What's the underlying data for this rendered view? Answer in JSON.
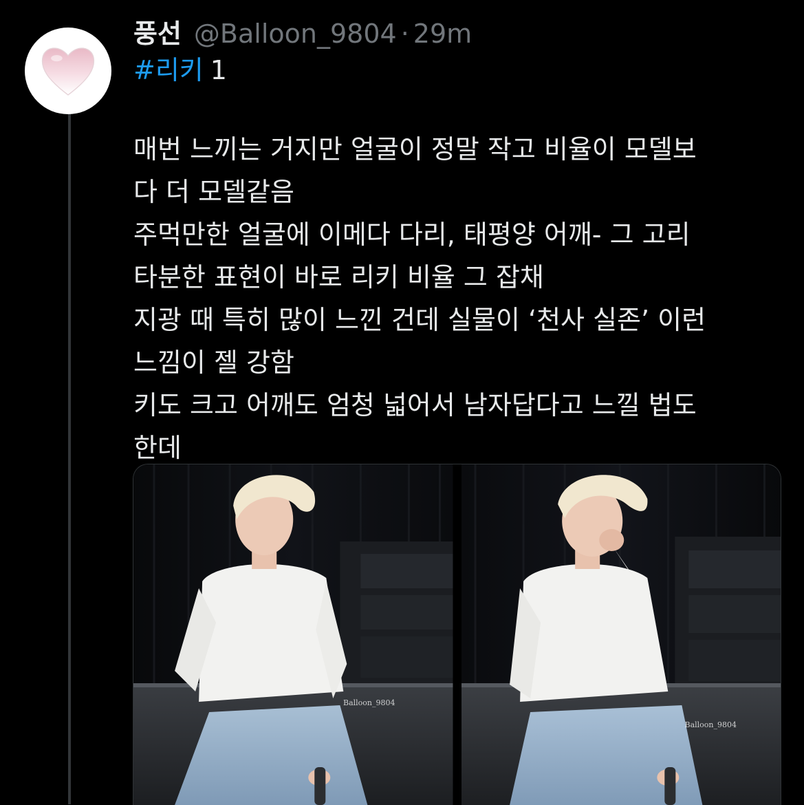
{
  "author": {
    "display_name": "풍선",
    "handle": "@Balloon_9804",
    "separator": "·",
    "time": "29m",
    "avatar_icon": "pink-heart-balloon-icon"
  },
  "hashtag": "#리키",
  "hashtag_suffix": "1",
  "tweet_lines": [
    "매번 느끼는 거지만 얼굴이 정말 작고 비율이 모델보",
    "다 더 모델같음",
    "주먹만한 얼굴에 이메다 다리, 태평양 어깨- 그 고리",
    "타분한 표현이 바로 리키 비율 그 잡채",
    "지광 때 특히 많이 느낀 건데 실물이 ‘천사 실존’ 이런",
    "느낌이 젤 강함",
    "키도 크고 어깨도 엄청 넓어서 남자답다고 느낄 법도",
    "한데"
  ],
  "media": [
    {
      "watermark": "Balloon_9804"
    },
    {
      "watermark": "Balloon_9804"
    }
  ],
  "colors": {
    "background": "#000000",
    "text": "#e7e9ea",
    "muted": "#71767b",
    "link": "#1d9bf0"
  }
}
